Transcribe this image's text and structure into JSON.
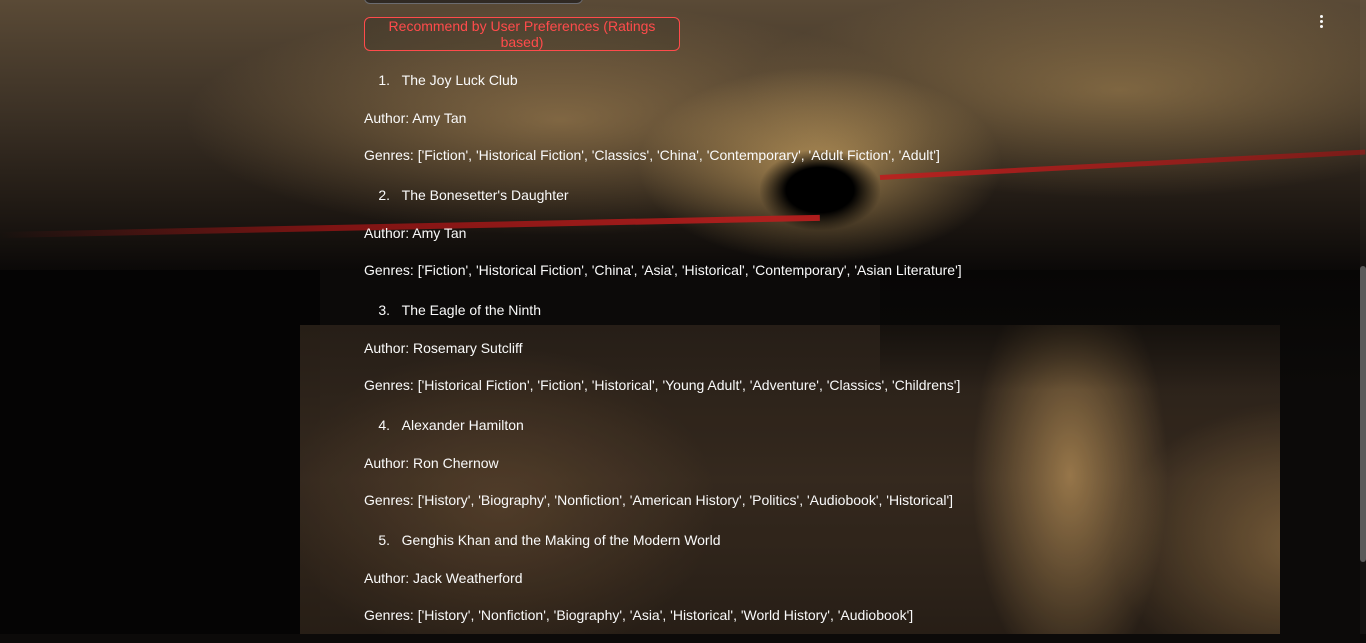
{
  "recommend_button": "Recommend by User Preferences (Ratings based)",
  "main_menu_icon": "vertical-dots-icon",
  "books": [
    {
      "number": "1.",
      "title": "The Joy Luck Club",
      "author": "Author: Amy Tan",
      "genres": "Genres: ['Fiction', 'Historical Fiction', 'Classics', 'China', 'Contemporary', 'Adult Fiction', 'Adult']"
    },
    {
      "number": "2.",
      "title": "The Bonesetter's Daughter",
      "author": "Author: Amy Tan",
      "genres": "Genres: ['Fiction', 'Historical Fiction', 'China', 'Asia', 'Historical', 'Contemporary', 'Asian Literature']"
    },
    {
      "number": "3.",
      "title": "The Eagle of the Ninth",
      "author": "Author: Rosemary Sutcliff",
      "genres": "Genres: ['Historical Fiction', 'Fiction', 'Historical', 'Young Adult', 'Adventure', 'Classics', 'Childrens']"
    },
    {
      "number": "4.",
      "title": "Alexander Hamilton",
      "author": "Author: Ron Chernow",
      "genres": "Genres: ['History', 'Biography', 'Nonfiction', 'American History', 'Politics', 'Audiobook', 'Historical']"
    },
    {
      "number": "5.",
      "title": "Genghis Khan and the Making of the Modern World",
      "author": "Author: Jack Weatherford",
      "genres": "Genres: ['History', 'Nonfiction', 'Biography', 'Asia', 'Historical', 'World History', 'Audiobook']"
    }
  ]
}
